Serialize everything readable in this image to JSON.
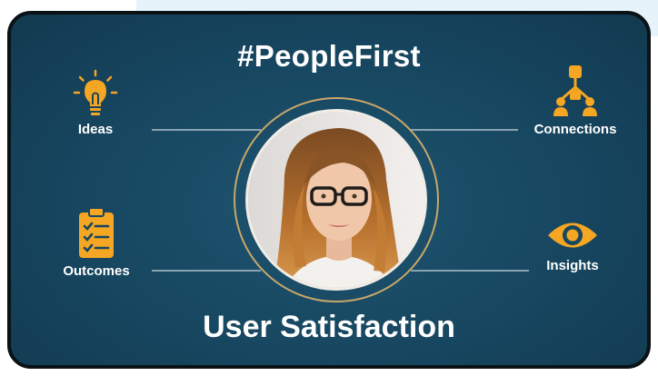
{
  "card": {
    "title": "#PeopleFirst",
    "footer": "User Satisfaction"
  },
  "features": {
    "ideas": {
      "label": "Ideas",
      "icon": "lightbulb-icon"
    },
    "connections": {
      "label": "Connections",
      "icon": "hierarchy-icon"
    },
    "outcomes": {
      "label": "Outcomes",
      "icon": "clipboard-checklist-icon"
    },
    "insights": {
      "label": "Insights",
      "icon": "eye-icon"
    }
  },
  "colors": {
    "card_bg": "#174660",
    "accent": "#f5a623",
    "text": "#ffffff",
    "ring": "#c9a76a"
  }
}
